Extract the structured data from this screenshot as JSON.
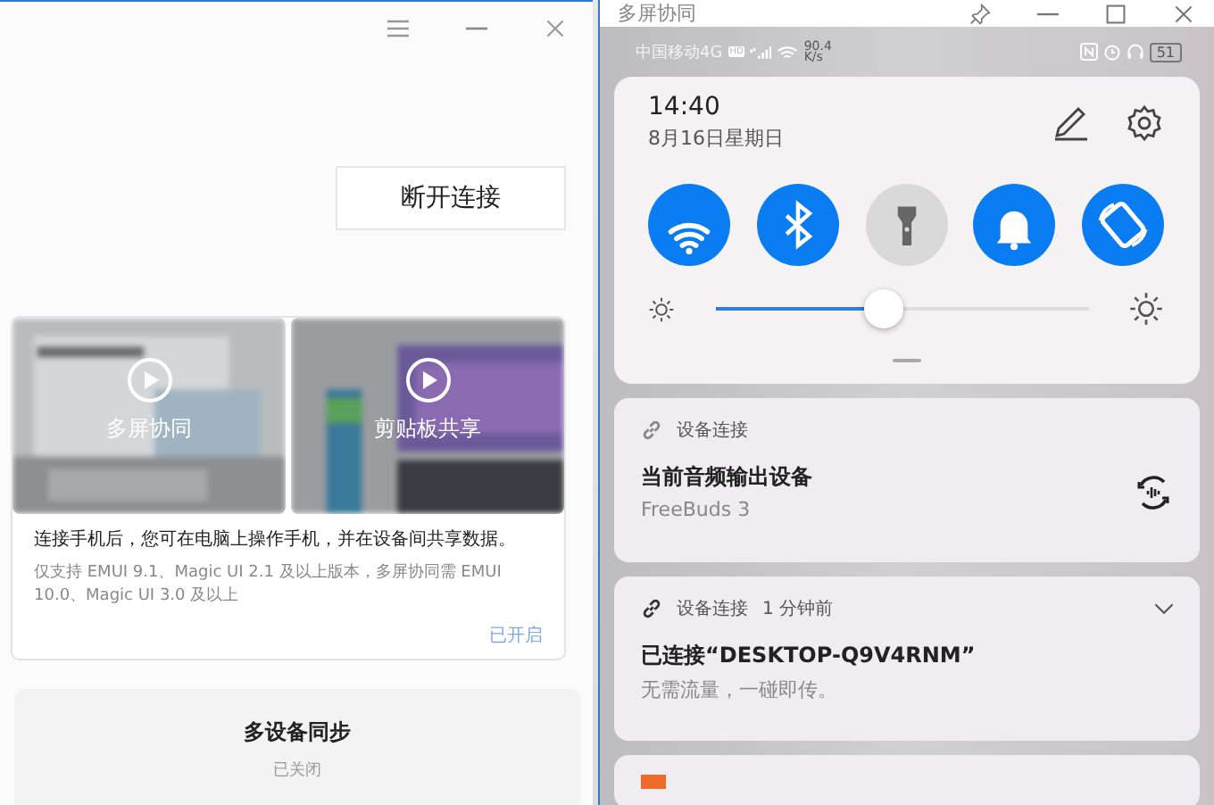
{
  "left_window": {
    "disconnect_button": "断开连接",
    "feature_tiles": [
      {
        "label": "多屏协同"
      },
      {
        "label": "剪贴板共享"
      }
    ],
    "feature_card": {
      "description": "连接手机后，您可在电脑上操作手机，并在设备间共享数据。",
      "note": "仅支持 EMUI 9.1、Magic UI 2.1 及以上版本，多屏协同需 EMUI 10.0、Magic UI 3.0 及以上",
      "status": "已开启"
    },
    "sync_card": {
      "title": "多设备同步",
      "status": "已关闭"
    }
  },
  "phone_window": {
    "title": "多屏协同",
    "status_bar": {
      "carrier": "中国移动4G",
      "hd": "HD",
      "speed": "90.4",
      "speed_unit": "K/s",
      "battery": "51"
    },
    "quick_panel": {
      "time": "14:40",
      "date": "8月16日星期日",
      "toggles": [
        {
          "kind": "wifi",
          "on": true
        },
        {
          "kind": "bluetooth",
          "on": true
        },
        {
          "kind": "flashlight",
          "on": false
        },
        {
          "kind": "bell",
          "on": true
        },
        {
          "kind": "rotate",
          "on": true
        }
      ],
      "brightness": {
        "level": 0.45
      }
    },
    "notifications": [
      {
        "app": "设备连接",
        "title": "当前音频输出设备",
        "body": "FreeBuds 3",
        "kind": "audio"
      },
      {
        "app": "设备连接",
        "time": "1 分钟前",
        "title": "已连接“DESKTOP-Q9V4RNM”",
        "body": "无需流量，一碰即传。",
        "kind": "expandable"
      }
    ]
  }
}
